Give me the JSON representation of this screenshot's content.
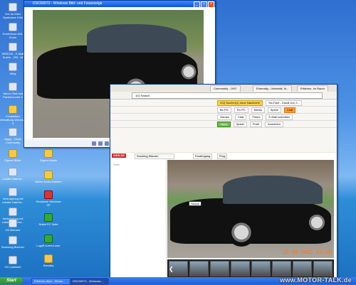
{
  "desktop_icons": [
    {
      "label": "Gut für Mich Sparkasse Köln",
      "kind": "app"
    },
    {
      "label": "Kostenlose AOL Konto",
      "kind": "app"
    },
    {
      "label": "WEB.DE - E-Mail Suche - 200 - M",
      "kind": "app"
    },
    {
      "label": "eBay",
      "kind": "app"
    },
    {
      "label": "Yahoo Chat und Partnersuche 3",
      "kind": "app"
    },
    {
      "label": "Festplatten Verwaltung Windows 3",
      "kind": "folder"
    },
    {
      "label": "Jappy - Deine Community",
      "kind": "app"
    },
    {
      "label": "Eigene Bilder",
      "kind": "folder"
    },
    {
      "label": "Eigene Musik",
      "kind": "folder"
    },
    {
      "label": "Lokaler Datentr...",
      "kind": "app"
    },
    {
      "label": "Meine Audio-Dateien",
      "kind": "folder"
    },
    {
      "label": "Verknüpfung mit Lokaler Datentr...",
      "kind": "app"
    },
    {
      "label": "Shutdown Windows XP",
      "kind": "red"
    },
    {
      "label": "Verknüpfung mit Lokaler Datentr...",
      "kind": "app"
    },
    {
      "label": "CD Brenner",
      "kind": "app"
    },
    {
      "label": "Nokia PC Suite",
      "kind": "green"
    },
    {
      "label": "Samsung Brenner",
      "kind": "app"
    },
    {
      "label": "Logoff current user",
      "kind": "green"
    },
    {
      "label": "CD Laufwerk",
      "kind": "app"
    },
    {
      "label": "Standby",
      "kind": "folder"
    }
  ],
  "viewer": {
    "title": "DSC00072 - Windows Bild- und Faxanzeige"
  },
  "browser": {
    "tabs": [
      "Community - 1997",
      "Ehemalig - Unterhalt, Ih...",
      "Erfahren- im Raum"
    ],
    "tab_prefix": "jappy.de",
    "address": "102 Search",
    "toolbar_items": [
      "ICQ Suchen(1) neue Nachricht!",
      "YouTube - Kanal von J..."
    ],
    "toolbar_row2": [
      "Bo PG",
      "Fix PC",
      "Media",
      "Spiele",
      "Chat"
    ],
    "toolbar_row3": [
      "Games",
      "Chat",
      "Pokes",
      "E-Mail schreiben"
    ],
    "toolbar_row4": [
      "Jappy",
      "Spiele",
      "Profil",
      "Anmelden"
    ],
    "page_logo": "WEB.DE",
    "page_search": "Smoking Warnen",
    "page_btns": [
      "Postengang",
      "Prog"
    ],
    "sidebar_label": "Hallo",
    "caption": "Gucca",
    "date_stamp": "17 06 2011 11:28"
  },
  "taskbar": {
    "start": "Start",
    "tasks": [
      "Erfahren-dfusi - Windo...",
      "DSC00072 - Windows..."
    ]
  },
  "watermark": "www.MOTOR-TALK.de"
}
